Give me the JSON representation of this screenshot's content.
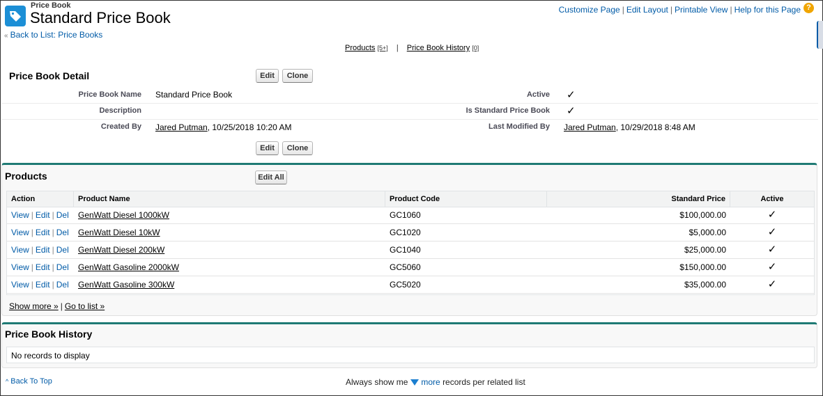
{
  "header": {
    "record_type": "Price Book",
    "title": "Standard Price Book",
    "back_link": "Back to List: Price Books",
    "top_links": [
      "Customize Page",
      "Edit Layout",
      "Printable View",
      "Help for this Page"
    ]
  },
  "related_nav": {
    "products_label": "Products",
    "products_count": "[5+]",
    "history_label": "Price Book History",
    "history_count": "[0]"
  },
  "detail": {
    "title": "Price Book Detail",
    "edit_label": "Edit",
    "clone_label": "Clone",
    "fields": {
      "name_label": "Price Book Name",
      "name_value": "Standard Price Book",
      "active_label": "Active",
      "description_label": "Description",
      "is_standard_label": "Is Standard Price Book",
      "created_label": "Created By",
      "created_user": "Jared Putman",
      "created_date": ", 10/25/2018 10:20 AM",
      "modified_label": "Last Modified By",
      "modified_user": "Jared Putman",
      "modified_date": ", 10/29/2018 8:48 AM"
    },
    "checkmark": "✓"
  },
  "products": {
    "title": "Products",
    "edit_all_label": "Edit All",
    "columns": [
      "Action",
      "Product Name",
      "Product Code",
      "Standard Price",
      "Active"
    ],
    "action_links": [
      "View",
      "Edit",
      "Del"
    ],
    "rows": [
      {
        "name": "GenWatt Diesel 1000kW",
        "code": "GC1060",
        "price": "$100,000.00",
        "active": "✓"
      },
      {
        "name": "GenWatt Diesel 10kW",
        "code": "GC1020",
        "price": "$5,000.00",
        "active": "✓"
      },
      {
        "name": "GenWatt Diesel 200kW",
        "code": "GC1040",
        "price": "$25,000.00",
        "active": "✓"
      },
      {
        "name": "GenWatt Gasoline 2000kW",
        "code": "GC5060",
        "price": "$150,000.00",
        "active": "✓"
      },
      {
        "name": "GenWatt Gasoline 300kW",
        "code": "GC5020",
        "price": "$35,000.00",
        "active": "✓"
      }
    ],
    "show_more": "Show more »",
    "go_to_list": "Go to list »"
  },
  "history": {
    "title": "Price Book History",
    "empty_text": "No records to display"
  },
  "footer": {
    "back_to_top": "Back To Top",
    "always_show_prefix": "Always show me",
    "more_link": "more",
    "always_show_suffix": "records per related list"
  },
  "colors": {
    "link": "#015ba7",
    "section_accent": "#1f7a74",
    "icon_bg": "#1c8fd6",
    "help_icon": "#f0a500"
  }
}
